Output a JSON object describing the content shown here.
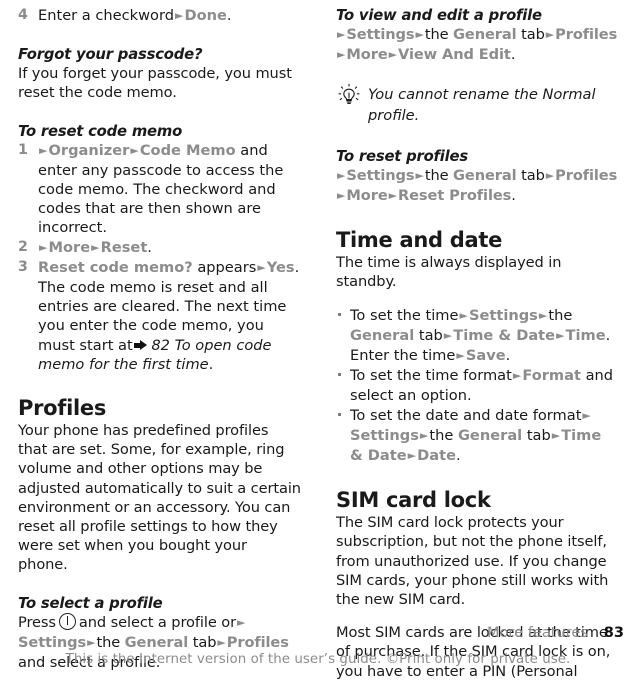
{
  "page": {
    "number": "83",
    "section": "More features",
    "footer_note": "This is the Internet version of the user’s guide. ©Print only for private use."
  },
  "left_column": {
    "step4": {
      "num": "4",
      "text_before": "Enter a checkword",
      "menu1": "Done",
      "text_after": "."
    },
    "forgot_heading": "Forgot your passcode?",
    "forgot_body": "If you forget your passcode, you must reset the code memo.",
    "reset_heading": "To reset code memo",
    "steps": [
      {
        "num": "1",
        "menu1": "Organizer",
        "menu2": "Code Memo",
        "text": "and enter any passcode to access the code memo. The checkword and codes that are then shown are incorrect."
      },
      {
        "num": "2",
        "menu1": "More",
        "menu2": "Reset",
        "text": "."
      },
      {
        "num": "3",
        "menu1": "Reset code memo?",
        "mid_text": "appears",
        "menu2": "Yes",
        "text": "The code memo is reset and all entries are cleared. The next time you enter the code memo, you must start at",
        "xref": "82 To open code memo for the first time",
        "xref_end": "."
      }
    ],
    "profiles_heading": "Profiles",
    "profiles_body": "Your phone has predefined profiles that are set. Some, for example, ring volume and other options may be adjusted automatically to suit a certain environment or an accessory. You can reset all profile settings to how they were set when you bought your phone.",
    "select_profile_heading": "To select a profile",
    "select_profile": {
      "press_label": "Press",
      "key_icon": "onoff-key-icon",
      "after_key": "and select a profile or",
      "menu_settings": "Settings",
      "the": "the",
      "menu_general": "General",
      "tab": "tab",
      "menu_profiles": "Profiles",
      "tail": "and select a profile."
    }
  },
  "right_column": {
    "view_edit_heading": "To view and edit a profile",
    "view_edit_path": {
      "menu_settings": "Settings",
      "the": "the",
      "menu_general": "General",
      "tab": "tab",
      "menu_profiles": "Profiles",
      "menu_more": "More",
      "menu_view_edit": "View And Edit",
      "period": "."
    },
    "tip": {
      "icon": "lightbulb-icon",
      "text": "You cannot rename the Normal profile."
    },
    "reset_profiles_heading": "To reset profiles",
    "reset_profiles_path": {
      "menu_settings": "Settings",
      "the": "the",
      "menu_general": "General",
      "tab": "tab",
      "menu_profiles": "Profiles",
      "menu_more": "More",
      "menu_reset_profiles": "Reset Profiles",
      "period": "."
    },
    "time_date_heading": "Time and date",
    "time_date_body": "The time is always displayed in standby.",
    "time_bullets": [
      {
        "t1": "To set the time",
        "m1": "Settings",
        "t2": "the",
        "m2": "General",
        "t3": "tab",
        "m3": "Time & Date",
        "m4": "Time",
        "t4": ". Enter the time",
        "m5": "Save",
        "t5": "."
      },
      {
        "t1": "To set the time format",
        "m1": "Format",
        "t2": "and select an option."
      },
      {
        "t1": "To set the date and date format",
        "m1": "Settings",
        "t2": "the",
        "m2": "General",
        "t3": "tab",
        "m3": "Time & Date",
        "m4": "Date",
        "t4": "."
      }
    ],
    "sim_heading": "SIM card lock",
    "sim_body1": "The SIM card lock protects your subscription, but not the phone itself, from unauthorized use. If you change SIM cards, your phone still works with the new SIM card.",
    "sim_body2": "Most SIM cards are locked at the time of purchase. If the SIM card lock is on, you have to enter a PIN (Personal"
  }
}
